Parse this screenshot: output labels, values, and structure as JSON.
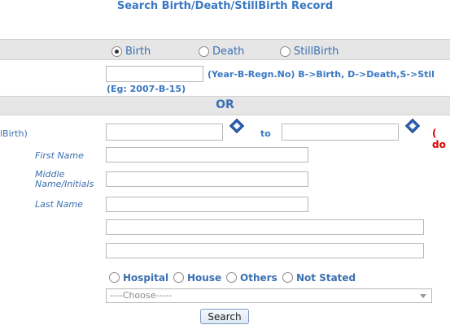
{
  "title": "Search Birth/Death/StillBirth Record",
  "record_type": {
    "options": [
      {
        "label": "Birth",
        "selected": true
      },
      {
        "label": "Death",
        "selected": false
      },
      {
        "label": "StillBirth",
        "selected": false
      }
    ]
  },
  "regn_hint": "(Year-B-Regn.No) B->Birth, D->Death,S->Stil",
  "regn_example": "(Eg: 2007-B-15)",
  "or_label": "OR",
  "date_row": {
    "left_label": "lBirth)",
    "to_label": "to",
    "right_label": "( do"
  },
  "name_fields": {
    "first": "First Name",
    "middle": "Middle Name/Initials",
    "last": "Last Name"
  },
  "place_options": [
    "Hospital",
    "House",
    "Others",
    "Not Stated"
  ],
  "choose_select": "----Choose-----",
  "search_button": "Search"
}
